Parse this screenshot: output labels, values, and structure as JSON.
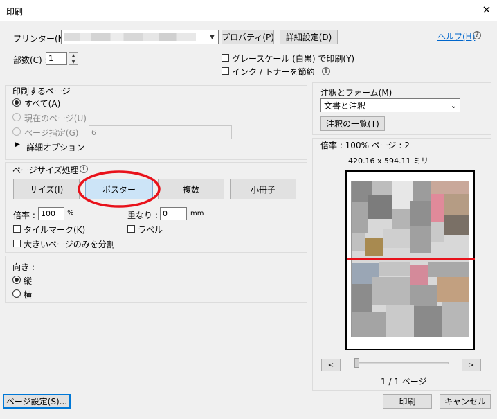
{
  "window": {
    "title": "印刷",
    "close_icon": "×"
  },
  "printer": {
    "label": "プリンター(N) :",
    "properties_button": "プロパティ(P)",
    "advanced_button": "詳細設定(D)",
    "help_link": "ヘルプ(H)"
  },
  "copies": {
    "label": "部数(C) :",
    "value": "1"
  },
  "options": {
    "grayscale": "グレースケール (白黒) で印刷(Y)",
    "save_ink": "インク / トナーを節約"
  },
  "pages": {
    "group_title": "印刷するページ",
    "all": "すべて(A)",
    "current": "現在のページ(U)",
    "range": "ページ指定(G)",
    "range_value": "6",
    "more_options": "詳細オプション"
  },
  "sizing": {
    "group_title": "ページサイズ処理",
    "size_button": "サイズ(I)",
    "poster_button": "ポスター",
    "multiple_button": "複数",
    "booklet_button": "小冊子",
    "scale_label": "倍率 :",
    "scale_value": "100",
    "scale_unit": "%",
    "overlap_label": "重なり :",
    "overlap_value": "0",
    "overlap_unit": "mm",
    "tile_marks": "タイルマーク(K)",
    "labels": "ラベル",
    "large_pages_only": "大きいページのみを分割"
  },
  "orientation": {
    "group_title": "向き :",
    "portrait": "縦",
    "landscape": "横"
  },
  "annotations": {
    "group_title": "注釈とフォーム(M)",
    "selected": "文書と注釈",
    "summary_button": "注釈の一覧(T)"
  },
  "preview": {
    "scale_text": "倍率 : 100% ページ : 2",
    "size_text": "420.16 x 594.11 ミリ",
    "prev_button": "<",
    "next_button": ">",
    "page_count": "1 / 1 ページ"
  },
  "footer": {
    "page_setup_button": "ページ設定(S)...",
    "print_button": "印刷",
    "cancel_button": "キャンセル"
  },
  "colors": {
    "highlight_red": "#e8121b",
    "link_blue": "#0066cc"
  }
}
